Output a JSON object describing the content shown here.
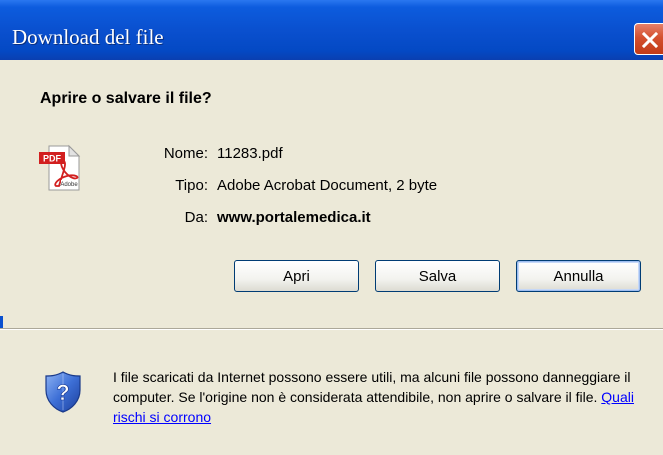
{
  "window": {
    "title": "Download del file"
  },
  "dialog": {
    "question": "Aprire o salvare il file?",
    "file": {
      "icon_badge": "PDF",
      "icon_caption": "Adobe",
      "name_label": "Nome:",
      "name_value": "11283.pdf",
      "type_label": "Tipo:",
      "type_value": "Adobe Acrobat Document, 2 byte",
      "from_label": "Da:",
      "from_value": "www.portalemedica.it"
    },
    "buttons": {
      "open": "Apri",
      "save": "Salva",
      "cancel": "Annulla"
    },
    "warning": {
      "text": "I file scaricati da Internet possono essere utili, ma alcuni file possono danneggiare il computer. Se l'origine non è considerata attendibile, non aprire o salvare il file. ",
      "link": "Quali rischi si corrono"
    }
  },
  "icons": {
    "close": "close-icon",
    "file": "pdf-file-icon",
    "shield": "security-shield-icon"
  },
  "colors": {
    "titlebar": "#0a50cf",
    "close_button": "#c23b17",
    "dialog_background": "#ece9d8",
    "link": "#0000ff"
  }
}
